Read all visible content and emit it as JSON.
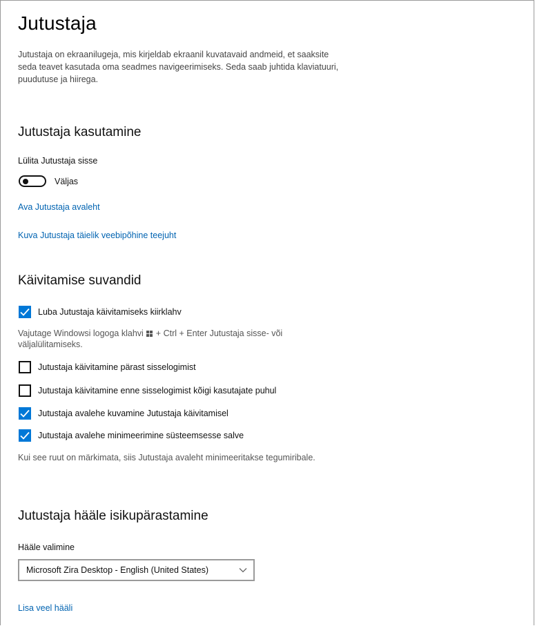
{
  "page": {
    "title": "Jutustaja",
    "intro": "Jutustaja on ekraanilugeja, mis kirjeldab ekraanil kuvatavaid andmeid, et saaksite seda teavet kasutada oma seadmes navigeerimiseks. Seda saab juhtida klaviatuuri, puudutuse ja hiirega."
  },
  "use_section": {
    "title": "Jutustaja kasutamine",
    "toggle_label": "Lülita Jutustaja sisse",
    "toggle_state": "Väljas",
    "toggle_on": false,
    "link_home": "Ava Jutustaja avaleht",
    "link_guide": "Kuva Jutustaja täielik veebipõhine teejuht"
  },
  "startup_section": {
    "title": "Käivitamise suvandid",
    "shortcut_checkbox": {
      "label": "Luba Jutustaja käivitamiseks kiirklahv",
      "checked": true
    },
    "shortcut_hint_before": "Vajutage Windowsi logoga klahvi",
    "shortcut_hint_after": "+ Ctrl + Enter Jutustaja sisse- või väljalülitamiseks.",
    "options": [
      {
        "label": "Jutustaja käivitamine pärast sisselogimist",
        "checked": false
      },
      {
        "label": "Jutustaja käivitamine enne sisselogimist kõigi kasutajate puhul",
        "checked": false
      },
      {
        "label": "Jutustaja avalehe kuvamine Jutustaja käivitamisel",
        "checked": true
      },
      {
        "label": "Jutustaja avalehe minimeerimine süsteemsesse salve",
        "checked": true
      }
    ],
    "tray_hint": "Kui see ruut on märkimata, siis Jutustaja avaleht minimeeritakse tegumiribale."
  },
  "voice_section": {
    "title": "Jutustaja hääle isikupärastamine",
    "voice_label": "Hääle valimine",
    "voice_value": "Microsoft Zira Desktop - English (United States)",
    "add_voice_link": "Lisa veel hääli"
  },
  "colors": {
    "accent": "#0078d7",
    "link": "#0063b1"
  },
  "icons": {
    "checkmark": "checkmark-icon",
    "windows_logo": "windows-logo-icon",
    "chevron": "chevron-down-icon"
  }
}
